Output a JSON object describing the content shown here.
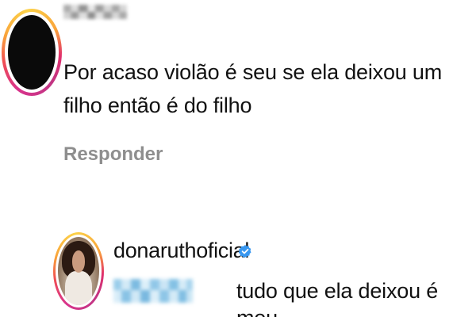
{
  "comment_1": {
    "text": "Por acaso violão é seu se ela deixou um filho então é do filho",
    "reply_label": "Responder"
  },
  "comment_2": {
    "username": "donaruthoficial",
    "verified_icon": "verified-badge-icon",
    "text": "tudo que ela deixou é meu"
  },
  "colors": {
    "text": "#111111",
    "secondary_text": "#8e8e8e",
    "verified_blue": "#3897f0",
    "story_ring_start": "#fcd249",
    "story_ring_end": "#d8338b"
  }
}
